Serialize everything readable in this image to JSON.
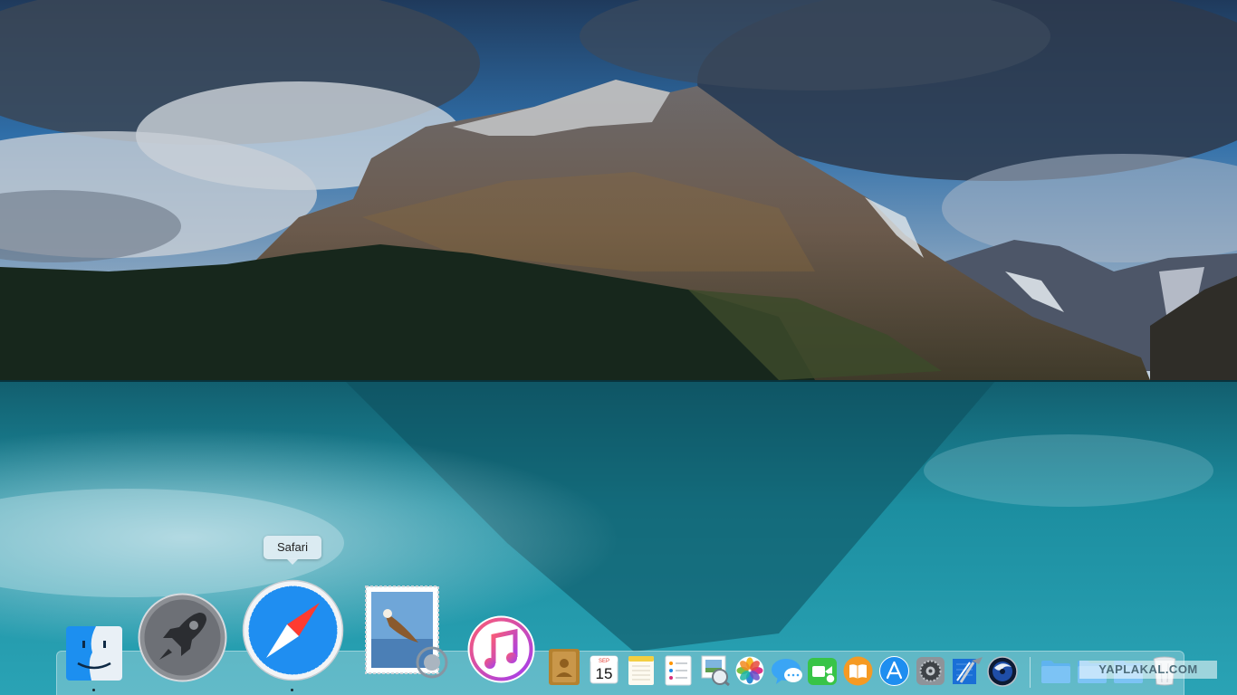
{
  "desktop": {
    "wallpaper": "Mountain lake wallpaper",
    "colors": {
      "lake": "#1e8da0",
      "sky": "#2a5e92",
      "forest": "#1a2f22"
    }
  },
  "tooltip": {
    "label": "Safari"
  },
  "dock": {
    "apps": [
      {
        "name": "Finder",
        "icon": "finder-icon",
        "running": true
      },
      {
        "name": "Launchpad",
        "icon": "launchpad-icon",
        "running": false
      },
      {
        "name": "Safari",
        "icon": "safari-icon",
        "running": true
      },
      {
        "name": "Mail",
        "icon": "mail-icon",
        "running": false
      },
      {
        "name": "iTunes",
        "icon": "itunes-icon",
        "running": false
      },
      {
        "name": "Contacts",
        "icon": "contacts-icon",
        "running": false
      },
      {
        "name": "Calendar",
        "icon": "calendar-icon",
        "running": false,
        "month": "SEP",
        "day": "15"
      },
      {
        "name": "Notes",
        "icon": "notes-icon",
        "running": false
      },
      {
        "name": "Reminders",
        "icon": "reminders-icon",
        "running": false
      },
      {
        "name": "Preview",
        "icon": "preview-icon",
        "running": false
      },
      {
        "name": "Photos",
        "icon": "photos-icon",
        "running": false
      },
      {
        "name": "Messages",
        "icon": "messages-icon",
        "running": false
      },
      {
        "name": "FaceTime",
        "icon": "facetime-icon",
        "running": false
      },
      {
        "name": "iBooks",
        "icon": "ibooks-icon",
        "running": false
      },
      {
        "name": "App Store",
        "icon": "app-store-icon",
        "running": false
      },
      {
        "name": "System Preferences",
        "icon": "system-preferences-icon",
        "running": false
      },
      {
        "name": "Xcode",
        "icon": "xcode-icon",
        "running": false
      },
      {
        "name": "Cinema 4D",
        "icon": "cinema4d-icon",
        "running": false
      }
    ],
    "stacks": [
      {
        "name": "Applications folder",
        "icon": "folder-icon"
      },
      {
        "name": "Documents folder",
        "icon": "folder-icon"
      },
      {
        "name": "Downloads folder",
        "icon": "folder-icon"
      },
      {
        "name": "Trash",
        "icon": "trash-icon"
      }
    ]
  },
  "watermark": {
    "text": "YAPLAKAL.COM"
  }
}
